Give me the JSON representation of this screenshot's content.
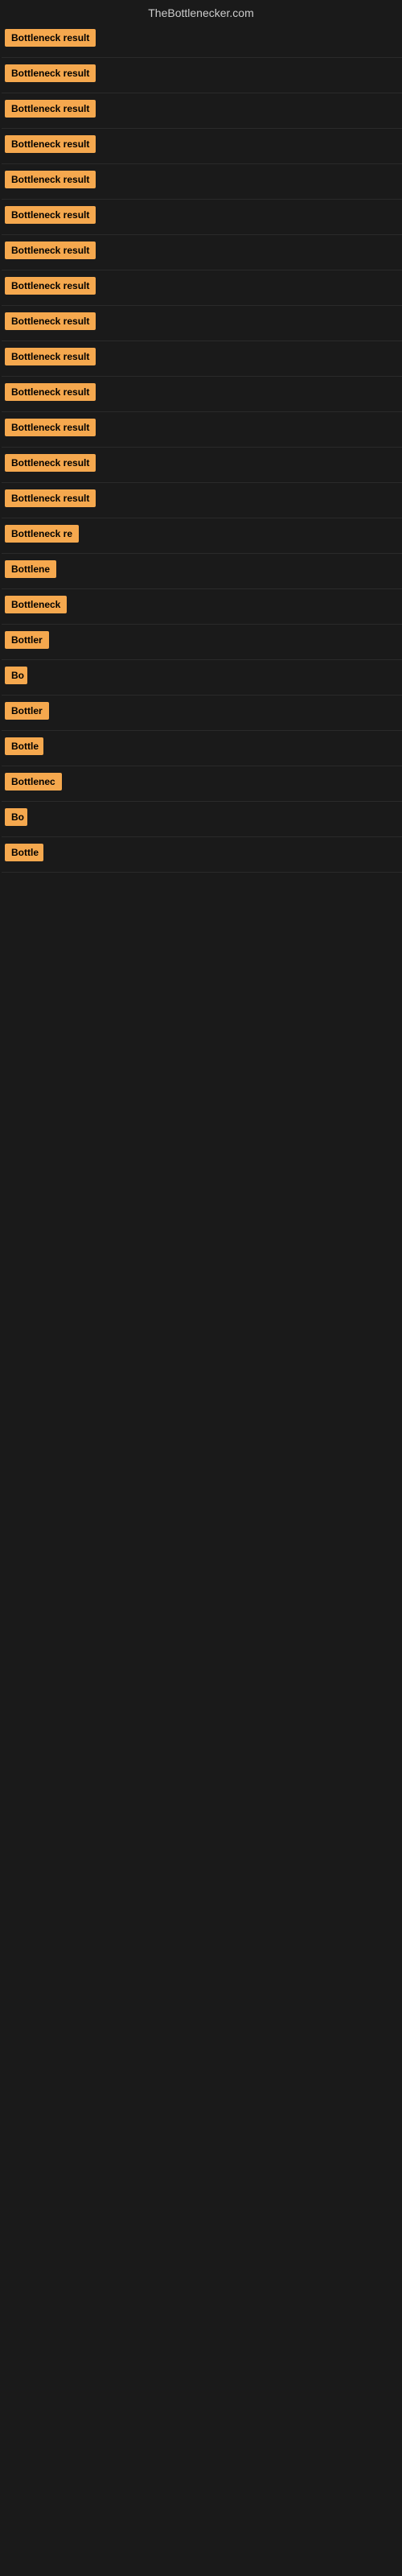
{
  "site": {
    "title": "TheBottlenecker.com"
  },
  "results": [
    {
      "id": 1,
      "label": "Bottleneck result",
      "visible_width": "full"
    },
    {
      "id": 2,
      "label": "Bottleneck result",
      "visible_width": "full"
    },
    {
      "id": 3,
      "label": "Bottleneck result",
      "visible_width": "full"
    },
    {
      "id": 4,
      "label": "Bottleneck result",
      "visible_width": "full"
    },
    {
      "id": 5,
      "label": "Bottleneck result",
      "visible_width": "full"
    },
    {
      "id": 6,
      "label": "Bottleneck result",
      "visible_width": "full"
    },
    {
      "id": 7,
      "label": "Bottleneck result",
      "visible_width": "full"
    },
    {
      "id": 8,
      "label": "Bottleneck result",
      "visible_width": "full"
    },
    {
      "id": 9,
      "label": "Bottleneck result",
      "visible_width": "full"
    },
    {
      "id": 10,
      "label": "Bottleneck result",
      "visible_width": "full"
    },
    {
      "id": 11,
      "label": "Bottleneck result",
      "visible_width": "full"
    },
    {
      "id": 12,
      "label": "Bottleneck result",
      "visible_width": "full"
    },
    {
      "id": 13,
      "label": "Bottleneck result",
      "visible_width": "full"
    },
    {
      "id": 14,
      "label": "Bottleneck result",
      "visible_width": "full"
    },
    {
      "id": 15,
      "label": "Bottleneck re",
      "visible_width": "partial-lg"
    },
    {
      "id": 16,
      "label": "Bottlene",
      "visible_width": "partial-md"
    },
    {
      "id": 17,
      "label": "Bottleneck",
      "visible_width": "partial-md2"
    },
    {
      "id": 18,
      "label": "Bottler",
      "visible_width": "partial-sm"
    },
    {
      "id": 19,
      "label": "Bo",
      "visible_width": "partial-xs"
    },
    {
      "id": 20,
      "label": "Bottler",
      "visible_width": "partial-sm2"
    },
    {
      "id": 21,
      "label": "Bottle",
      "visible_width": "partial-sm3"
    },
    {
      "id": 22,
      "label": "Bottlenec",
      "visible_width": "partial-md3"
    },
    {
      "id": 23,
      "label": "Bo",
      "visible_width": "partial-xs2"
    },
    {
      "id": 24,
      "label": "Bottle",
      "visible_width": "partial-sm4"
    }
  ],
  "badge": {
    "bg_color": "#f5a84e",
    "text_color": "#000000"
  }
}
